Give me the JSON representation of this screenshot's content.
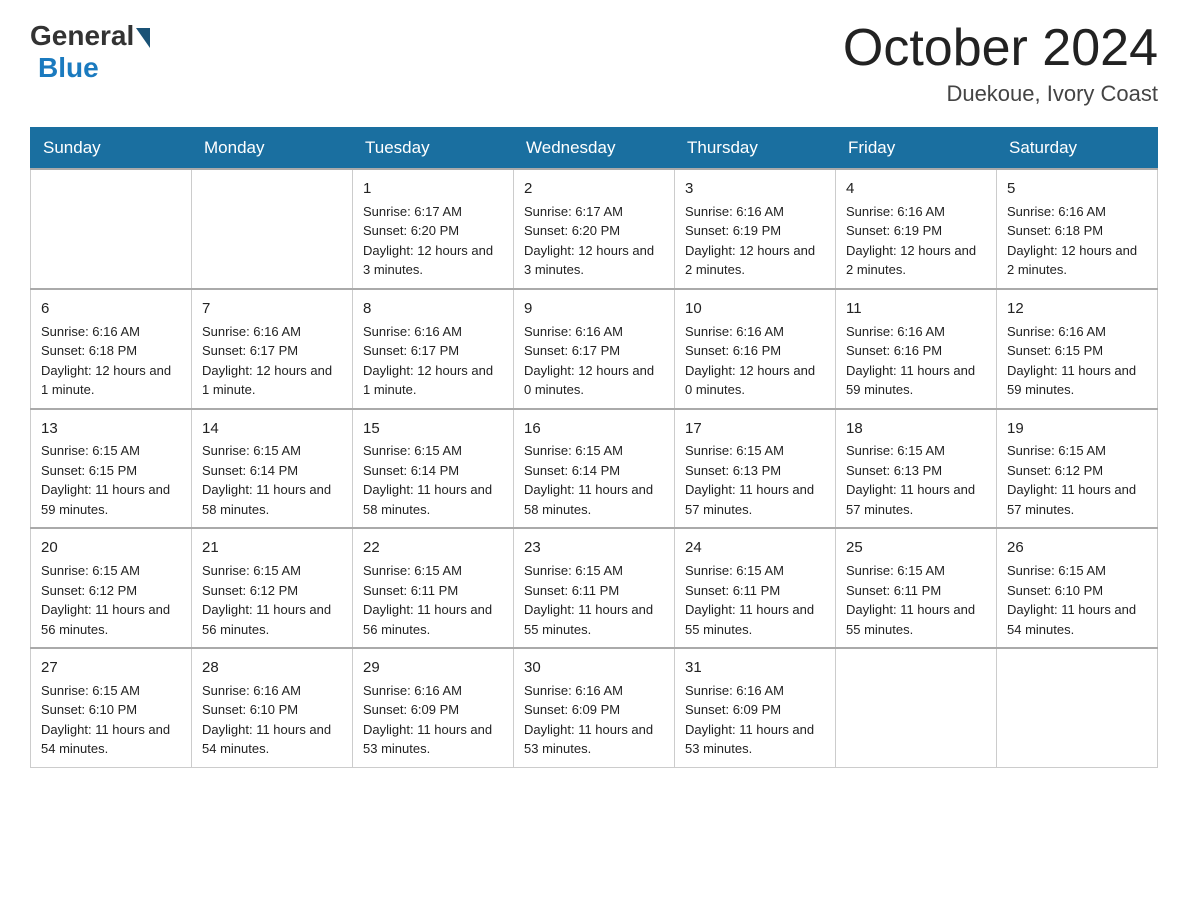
{
  "logo": {
    "general": "General",
    "blue": "Blue"
  },
  "title": "October 2024",
  "location": "Duekoue, Ivory Coast",
  "days_of_week": [
    "Sunday",
    "Monday",
    "Tuesday",
    "Wednesday",
    "Thursday",
    "Friday",
    "Saturday"
  ],
  "weeks": [
    [
      {
        "day": "",
        "info": ""
      },
      {
        "day": "",
        "info": ""
      },
      {
        "day": "1",
        "info": "Sunrise: 6:17 AM\nSunset: 6:20 PM\nDaylight: 12 hours\nand 3 minutes."
      },
      {
        "day": "2",
        "info": "Sunrise: 6:17 AM\nSunset: 6:20 PM\nDaylight: 12 hours\nand 3 minutes."
      },
      {
        "day": "3",
        "info": "Sunrise: 6:16 AM\nSunset: 6:19 PM\nDaylight: 12 hours\nand 2 minutes."
      },
      {
        "day": "4",
        "info": "Sunrise: 6:16 AM\nSunset: 6:19 PM\nDaylight: 12 hours\nand 2 minutes."
      },
      {
        "day": "5",
        "info": "Sunrise: 6:16 AM\nSunset: 6:18 PM\nDaylight: 12 hours\nand 2 minutes."
      }
    ],
    [
      {
        "day": "6",
        "info": "Sunrise: 6:16 AM\nSunset: 6:18 PM\nDaylight: 12 hours\nand 1 minute."
      },
      {
        "day": "7",
        "info": "Sunrise: 6:16 AM\nSunset: 6:17 PM\nDaylight: 12 hours\nand 1 minute."
      },
      {
        "day": "8",
        "info": "Sunrise: 6:16 AM\nSunset: 6:17 PM\nDaylight: 12 hours\nand 1 minute."
      },
      {
        "day": "9",
        "info": "Sunrise: 6:16 AM\nSunset: 6:17 PM\nDaylight: 12 hours\nand 0 minutes."
      },
      {
        "day": "10",
        "info": "Sunrise: 6:16 AM\nSunset: 6:16 PM\nDaylight: 12 hours\nand 0 minutes."
      },
      {
        "day": "11",
        "info": "Sunrise: 6:16 AM\nSunset: 6:16 PM\nDaylight: 11 hours\nand 59 minutes."
      },
      {
        "day": "12",
        "info": "Sunrise: 6:16 AM\nSunset: 6:15 PM\nDaylight: 11 hours\nand 59 minutes."
      }
    ],
    [
      {
        "day": "13",
        "info": "Sunrise: 6:15 AM\nSunset: 6:15 PM\nDaylight: 11 hours\nand 59 minutes."
      },
      {
        "day": "14",
        "info": "Sunrise: 6:15 AM\nSunset: 6:14 PM\nDaylight: 11 hours\nand 58 minutes."
      },
      {
        "day": "15",
        "info": "Sunrise: 6:15 AM\nSunset: 6:14 PM\nDaylight: 11 hours\nand 58 minutes."
      },
      {
        "day": "16",
        "info": "Sunrise: 6:15 AM\nSunset: 6:14 PM\nDaylight: 11 hours\nand 58 minutes."
      },
      {
        "day": "17",
        "info": "Sunrise: 6:15 AM\nSunset: 6:13 PM\nDaylight: 11 hours\nand 57 minutes."
      },
      {
        "day": "18",
        "info": "Sunrise: 6:15 AM\nSunset: 6:13 PM\nDaylight: 11 hours\nand 57 minutes."
      },
      {
        "day": "19",
        "info": "Sunrise: 6:15 AM\nSunset: 6:12 PM\nDaylight: 11 hours\nand 57 minutes."
      }
    ],
    [
      {
        "day": "20",
        "info": "Sunrise: 6:15 AM\nSunset: 6:12 PM\nDaylight: 11 hours\nand 56 minutes."
      },
      {
        "day": "21",
        "info": "Sunrise: 6:15 AM\nSunset: 6:12 PM\nDaylight: 11 hours\nand 56 minutes."
      },
      {
        "day": "22",
        "info": "Sunrise: 6:15 AM\nSunset: 6:11 PM\nDaylight: 11 hours\nand 56 minutes."
      },
      {
        "day": "23",
        "info": "Sunrise: 6:15 AM\nSunset: 6:11 PM\nDaylight: 11 hours\nand 55 minutes."
      },
      {
        "day": "24",
        "info": "Sunrise: 6:15 AM\nSunset: 6:11 PM\nDaylight: 11 hours\nand 55 minutes."
      },
      {
        "day": "25",
        "info": "Sunrise: 6:15 AM\nSunset: 6:11 PM\nDaylight: 11 hours\nand 55 minutes."
      },
      {
        "day": "26",
        "info": "Sunrise: 6:15 AM\nSunset: 6:10 PM\nDaylight: 11 hours\nand 54 minutes."
      }
    ],
    [
      {
        "day": "27",
        "info": "Sunrise: 6:15 AM\nSunset: 6:10 PM\nDaylight: 11 hours\nand 54 minutes."
      },
      {
        "day": "28",
        "info": "Sunrise: 6:16 AM\nSunset: 6:10 PM\nDaylight: 11 hours\nand 54 minutes."
      },
      {
        "day": "29",
        "info": "Sunrise: 6:16 AM\nSunset: 6:09 PM\nDaylight: 11 hours\nand 53 minutes."
      },
      {
        "day": "30",
        "info": "Sunrise: 6:16 AM\nSunset: 6:09 PM\nDaylight: 11 hours\nand 53 minutes."
      },
      {
        "day": "31",
        "info": "Sunrise: 6:16 AM\nSunset: 6:09 PM\nDaylight: 11 hours\nand 53 minutes."
      },
      {
        "day": "",
        "info": ""
      },
      {
        "day": "",
        "info": ""
      }
    ]
  ]
}
